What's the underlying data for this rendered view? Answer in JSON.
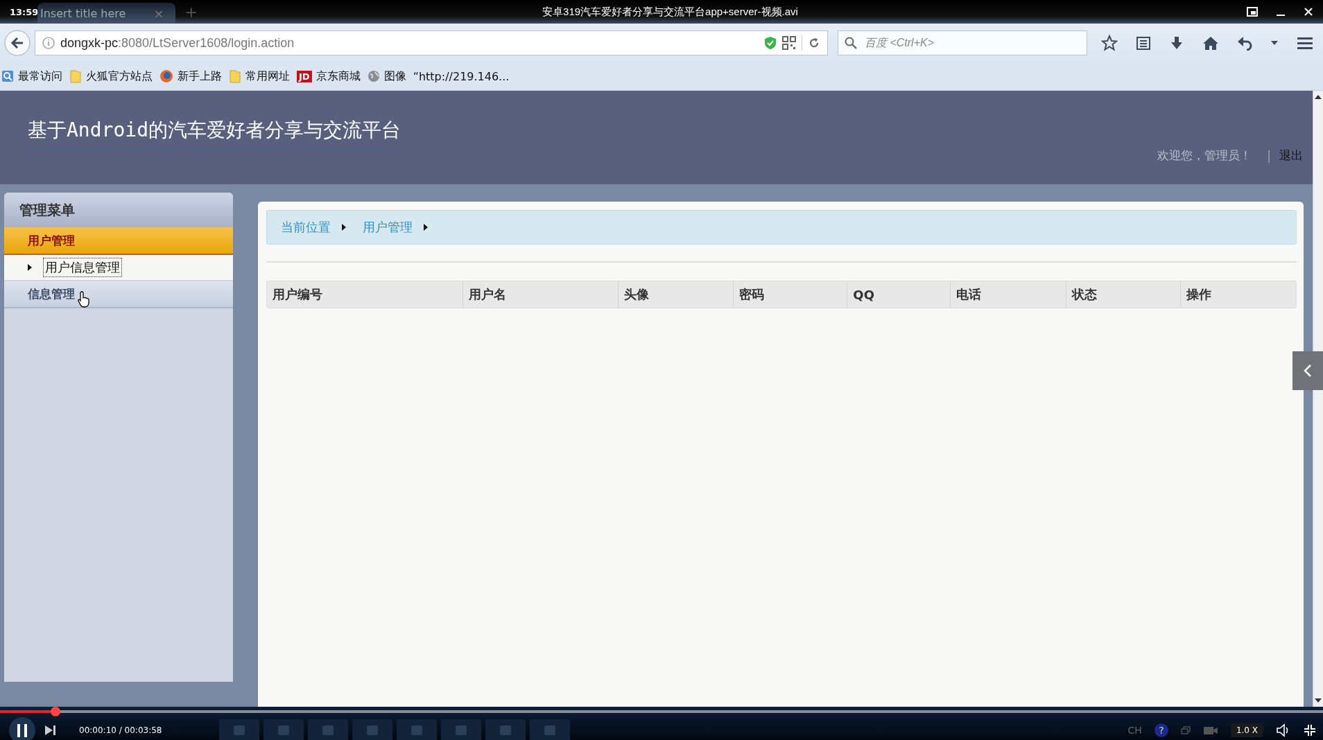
{
  "player": {
    "clock": "13:59",
    "title": "安卓319汽车爱好者分享与交流平台app+server-视频.avi",
    "progress": {
      "level": 0.042
    },
    "time": "00:00:10 / 00:03:58",
    "ime": "CH",
    "help": "?",
    "speed": "1.0 X"
  },
  "browser": {
    "tab": {
      "title": "Insert title here",
      "close": "×",
      "new_tab": "+"
    },
    "url": {
      "host": "dongxk-pc",
      "rest": ":8080/LtServer1608/login.action"
    },
    "search": {
      "placeholder": "百度 <Ctrl+K>"
    },
    "bookmarks": [
      {
        "kind": "star",
        "label": "最常访问"
      },
      {
        "kind": "folder",
        "label": "火狐官方站点"
      },
      {
        "kind": "firefox",
        "label": "新手上路"
      },
      {
        "kind": "folder",
        "label": "常用网址"
      },
      {
        "kind": "jd",
        "badge": "JD",
        "label": "京东商城"
      },
      {
        "kind": "globe",
        "label": "图像"
      },
      {
        "kind": "none",
        "label": "“http://219.146..."
      }
    ]
  },
  "page": {
    "title": "基于Android的汽车爱好者分享与交流平台",
    "welcome": "欢迎您，管理员！",
    "separator": "|",
    "logout": "退出",
    "sidebar": {
      "heading": "管理菜单",
      "groups": [
        {
          "label": "用户管理",
          "expanded": true,
          "children": [
            {
              "label": "用户信息管理",
              "selected": true
            }
          ]
        },
        {
          "label": "信息管理",
          "expanded": false
        }
      ]
    },
    "breadcrumb": [
      "当前位置",
      "用户管理"
    ],
    "table": {
      "columns": [
        "用户编号",
        "用户名",
        "头像",
        "密码",
        "QQ",
        "电话",
        "状态",
        "操作"
      ]
    }
  }
}
